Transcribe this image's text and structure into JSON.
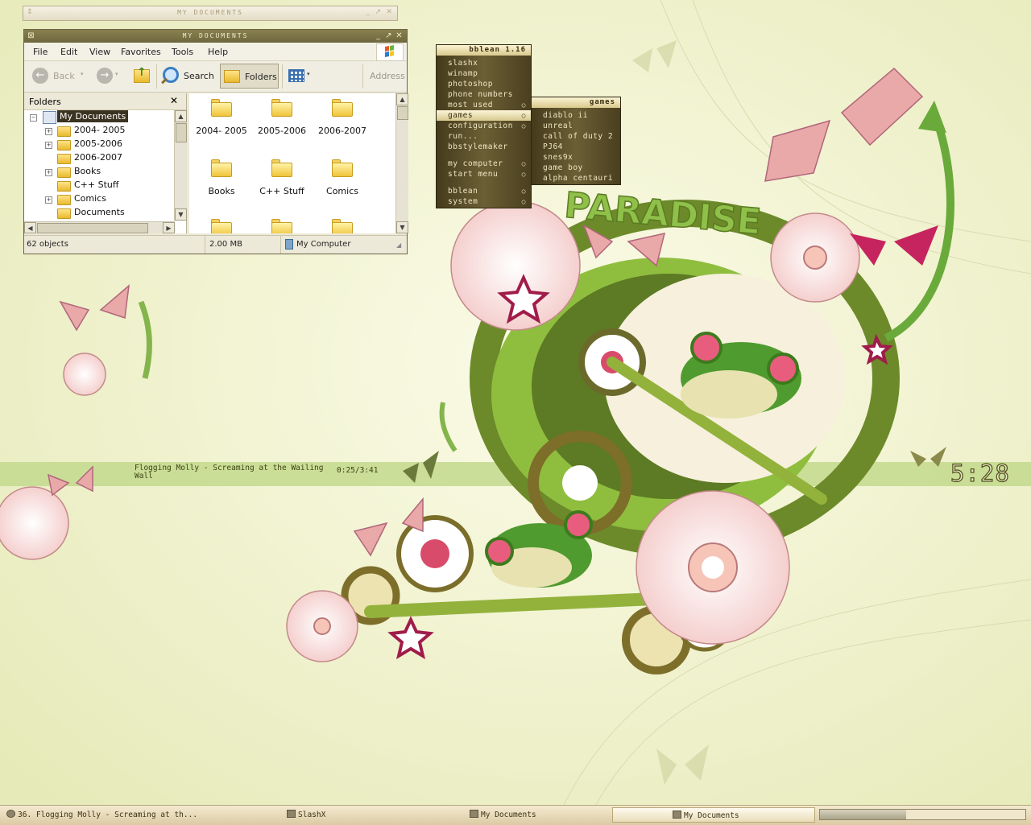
{
  "colors": {
    "accent": "#6b5f35",
    "wall_bg": "#eef0c8",
    "band": "#b8d37a"
  },
  "ghost_window": {
    "title": "MY DOCUMENTS"
  },
  "explorer": {
    "title": "MY DOCUMENTS",
    "menu": [
      "File",
      "Edit",
      "View",
      "Favorites",
      "Tools",
      "Help"
    ],
    "toolbar": {
      "back": "Back",
      "search": "Search",
      "folders": "Folders",
      "address": "Address"
    },
    "folders_pane": {
      "title": "Folders",
      "close": "✕"
    },
    "tree": [
      {
        "label": "My Documents",
        "expand": "−",
        "selected": true
      },
      {
        "label": "2004- 2005",
        "expand": "+"
      },
      {
        "label": "2005-2006",
        "expand": "+"
      },
      {
        "label": "2006-2007",
        "expand": ""
      },
      {
        "label": "Books",
        "expand": "+"
      },
      {
        "label": "C++ Stuff",
        "expand": ""
      },
      {
        "label": "Comics",
        "expand": "+"
      },
      {
        "label": "Documents",
        "expand": ""
      }
    ],
    "files": [
      "2004- 2005",
      "2005-2006",
      "2006-2007",
      "Books",
      "C++ Stuff",
      "Comics",
      "",
      "",
      ""
    ],
    "status": {
      "objects": "62 objects",
      "size": "2.00 MB",
      "location": "My Computer"
    }
  },
  "bb_menu": {
    "title": "bblean 1.16",
    "items": [
      {
        "label": "slashx",
        "sub": false
      },
      {
        "label": "winamp",
        "sub": false
      },
      {
        "label": "photoshop",
        "sub": false
      },
      {
        "label": "phone numbers",
        "sub": false
      },
      {
        "label": "most used",
        "sub": true
      },
      {
        "label": "games",
        "sub": true,
        "selected": true
      },
      {
        "label": "configuration",
        "sub": true
      },
      {
        "label": "run...",
        "sub": false
      },
      {
        "label": "bbstylemaker",
        "sub": false
      },
      {
        "label": "my computer",
        "sub": true
      },
      {
        "label": "start menu",
        "sub": true
      },
      {
        "label": "bblean",
        "sub": true
      },
      {
        "label": "system",
        "sub": true
      }
    ]
  },
  "games_menu": {
    "title": "games",
    "items": [
      "diablo ii",
      "unreal",
      "call of duty 2",
      "PJ64",
      "snes9x",
      "game boy",
      "alpha centauri"
    ]
  },
  "now_playing": {
    "line1": "Flogging Molly - Screaming at the Wailing",
    "line2": "Wall",
    "time": "0:25/3:41"
  },
  "clock": "5:28",
  "wallpaper": {
    "logo_text": "PARADISE"
  },
  "taskbar": {
    "tasks": [
      "36. Flogging Molly - Screaming at th...",
      "SlashX",
      "My Documents",
      "My Documents"
    ],
    "active_index": 3,
    "progress": 0.42
  }
}
